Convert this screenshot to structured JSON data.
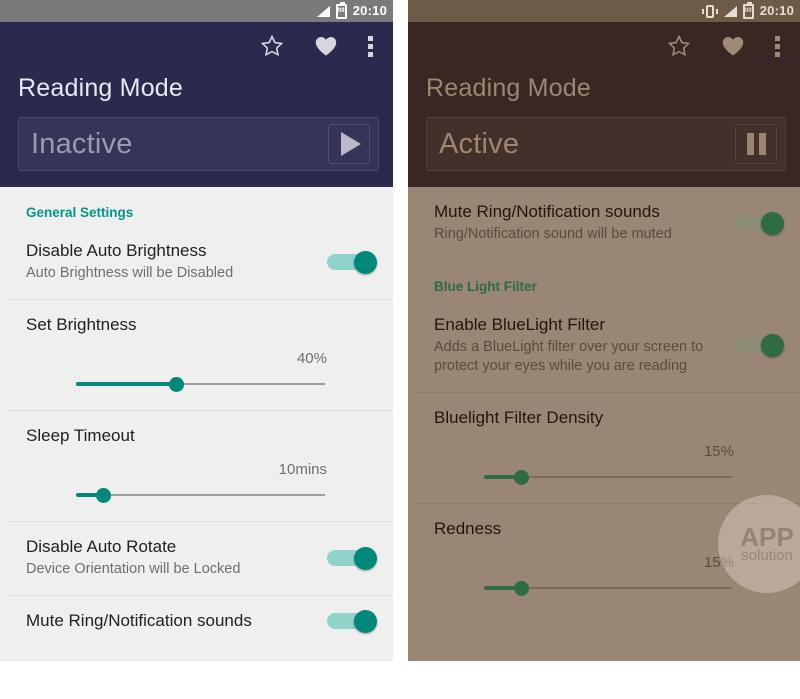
{
  "left_phone": {
    "status_bar": {
      "time": "20:10",
      "battery_level": "99",
      "icons": [
        "signal-icon",
        "battery-icon"
      ]
    },
    "app_bar": {
      "title": "Reading Mode",
      "actions": [
        "star-icon",
        "heart-icon",
        "overflow-menu-icon"
      ],
      "state_label": "Inactive",
      "state_button_icon": "play-icon"
    },
    "sections": [
      {
        "header": "General Settings",
        "rows": [
          {
            "type": "toggle",
            "title": "Disable Auto Brightness",
            "subtitle": "Auto Brightness will be Disabled",
            "on": true
          },
          {
            "type": "slider",
            "title": "Set Brightness",
            "value_label": "40%",
            "percent": 40
          },
          {
            "type": "slider",
            "title": "Sleep Timeout",
            "value_label": "10mins",
            "percent": 11
          },
          {
            "type": "toggle",
            "title": "Disable Auto Rotate",
            "subtitle": "Device Orientation will be Locked",
            "on": true
          },
          {
            "type": "toggle",
            "title": "Mute Ring/Notification sounds",
            "subtitle": "",
            "on": true
          }
        ]
      }
    ],
    "colors": {
      "app_bar": "#2a2a4f",
      "accent": "#00897b",
      "background": "#efefef",
      "status_bar": "#7a7a7a"
    }
  },
  "right_phone": {
    "status_bar": {
      "time": "20:10",
      "battery_level": "99",
      "icons": [
        "vibrate-icon",
        "signal-icon",
        "battery-icon"
      ]
    },
    "app_bar": {
      "title": "Reading Mode",
      "actions": [
        "star-icon",
        "heart-icon",
        "overflow-menu-icon"
      ],
      "state_label": "Active",
      "state_button_icon": "pause-icon"
    },
    "rows_top": [
      {
        "type": "toggle",
        "title": "Mute Ring/Notification sounds",
        "subtitle": "Ring/Notification sound will be muted",
        "on": true
      }
    ],
    "sections": [
      {
        "header": "Blue Light Filter",
        "rows": [
          {
            "type": "toggle",
            "title": "Enable BlueLight Filter",
            "subtitle": "Adds a BlueLight filter over your screen to protect your eyes while you are reading",
            "on": true
          },
          {
            "type": "slider",
            "title": "Bluelight Filter Density",
            "value_label": "15%",
            "percent": 15
          },
          {
            "type": "slider",
            "title": "Redness",
            "value_label": "15%",
            "percent": 15
          }
        ]
      }
    ],
    "watermark": {
      "line1": "APP",
      "line2": "solution"
    },
    "colors": {
      "app_bar": "#3a2622",
      "accent": "#2f6b45",
      "background": "#9a8674",
      "status_bar": "#6d5a47"
    }
  }
}
